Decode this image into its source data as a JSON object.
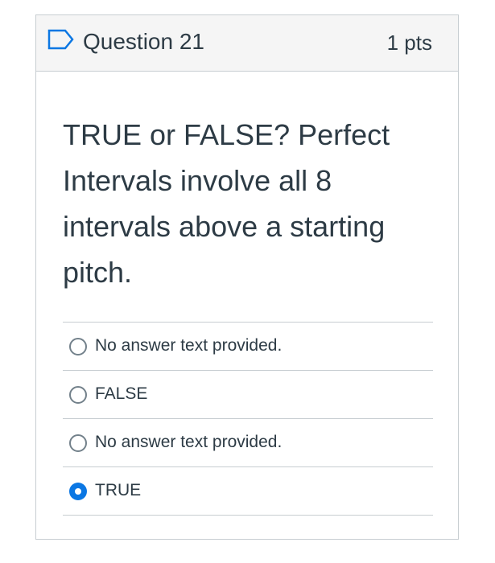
{
  "question": {
    "title": "Question 21",
    "points": "1 pts",
    "text": "TRUE or FALSE?  Perfect Intervals involve all 8 intervals above a starting pitch.",
    "flag_icon": "flag-outline-icon"
  },
  "answers": [
    {
      "label": "No answer text provided.",
      "selected": false
    },
    {
      "label": "FALSE",
      "selected": false
    },
    {
      "label": "No answer text provided.",
      "selected": false
    },
    {
      "label": "TRUE",
      "selected": true
    }
  ],
  "colors": {
    "text": "#2d3b45",
    "border": "#c7cdd1",
    "header_bg": "#f5f5f5",
    "radio_selected": "#0b77e3",
    "radio_unselected": "#73818b"
  }
}
